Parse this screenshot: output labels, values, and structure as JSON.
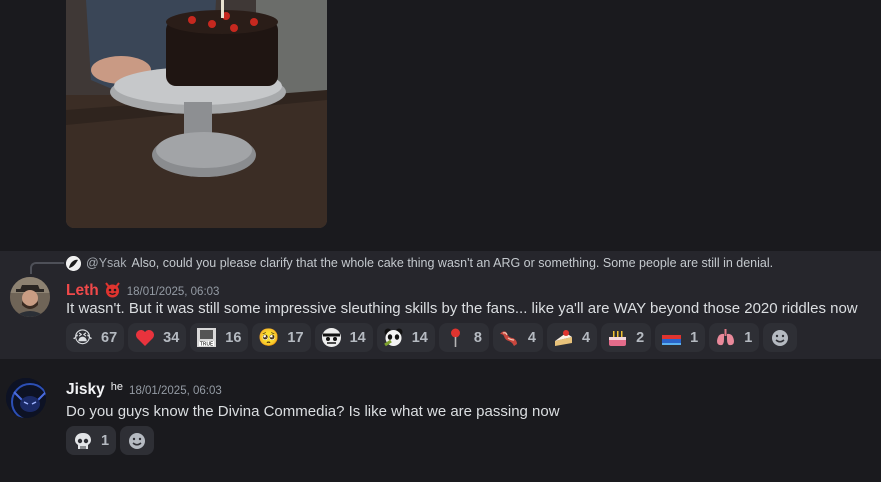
{
  "reply": {
    "mention": "@Ysak",
    "text": "Also, could you please clarify that the whole cake thing wasn't an ARG or something. Some people are still in denial."
  },
  "messages": [
    {
      "username": "Leth",
      "username_color": "#f0494a",
      "timestamp": "18/01/2025, 06:03",
      "content": "It wasn't. But it was still some impressive sleuthing skills by the fans... like ya'll are WAY beyond those 2020 riddles now",
      "reactions": [
        {
          "icon": "loudly-crying-face-icon",
          "glyph": "😭",
          "count": "67"
        },
        {
          "icon": "red-heart-icon",
          "glyph": "❤",
          "count": "34"
        },
        {
          "icon": "true-sticker-icon",
          "glyph": "",
          "count": "16"
        },
        {
          "icon": "pleading-face-icon",
          "glyph": "🥺",
          "count": "17"
        },
        {
          "icon": "custom-face-icon",
          "glyph": "",
          "count": "14"
        },
        {
          "icon": "custom-panda-icon",
          "glyph": "",
          "count": "14"
        },
        {
          "icon": "round-pushpin-icon",
          "glyph": "📍",
          "count": "8"
        },
        {
          "icon": "bacon-icon",
          "glyph": "🥓",
          "count": "4"
        },
        {
          "icon": "shortcake-icon",
          "glyph": "🍰",
          "count": "4"
        },
        {
          "icon": "birthday-cake-icon",
          "glyph": "🎂",
          "count": "2"
        },
        {
          "icon": "flag-icon",
          "glyph": "",
          "count": "1"
        },
        {
          "icon": "lungs-icon",
          "glyph": "🫁",
          "count": "1"
        }
      ]
    },
    {
      "username": "Jisky",
      "username_color": "#f2f3f5",
      "tag": "he",
      "timestamp": "18/01/2025, 06:03",
      "content": "Do you guys know the Divina Commedia? Is like what we are passing now",
      "reactions": [
        {
          "icon": "skull-icon",
          "glyph": "💀",
          "count": "1"
        }
      ]
    }
  ],
  "colors": {
    "background": "#1a1a1e",
    "highlight": "#26262c",
    "reaction_bg": "#2e2f35",
    "text": "#dbdee1",
    "muted": "#949ba4"
  }
}
